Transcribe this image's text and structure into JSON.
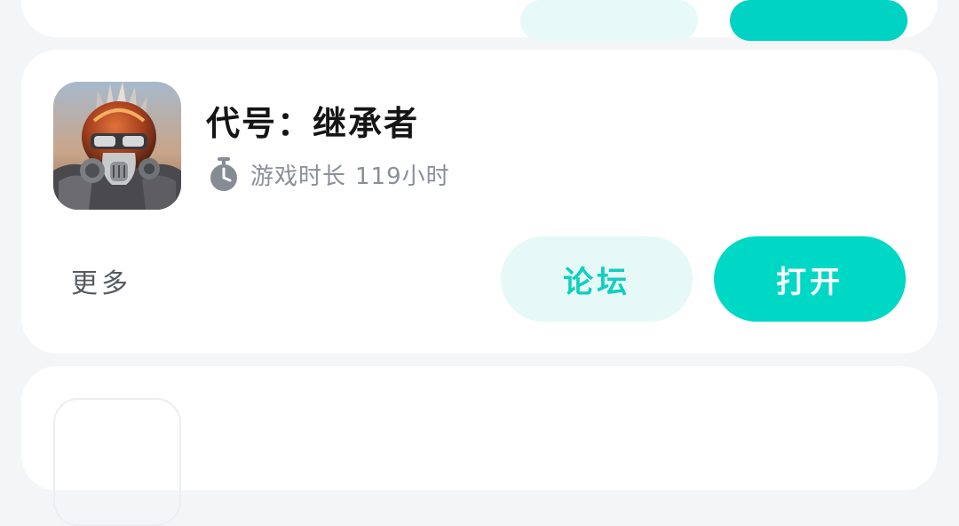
{
  "game": {
    "title": "代号：继承者",
    "playtime_label": "游戏时长",
    "playtime_value": "119小时",
    "icon": "game-cover-icon"
  },
  "actions": {
    "more_label": "更多",
    "forum_label": "论坛",
    "open_label": "打开"
  },
  "colors": {
    "accent": "#00d8c6",
    "accent_light": "#e6f9f7",
    "page_background": "#f3f5f7",
    "card_background": "#ffffff",
    "secondary_text": "#8a8f98"
  }
}
